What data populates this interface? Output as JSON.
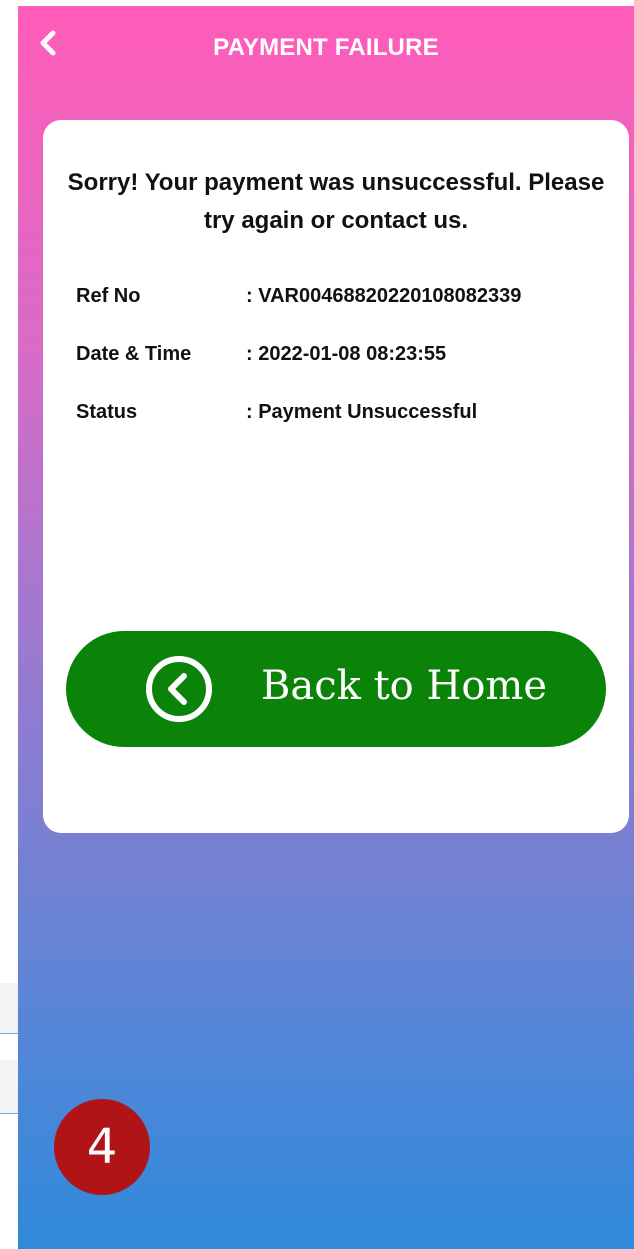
{
  "header": {
    "title": "PAYMENT FAILURE",
    "back_icon": "chevron-left-icon"
  },
  "card": {
    "message": "Sorry! Your payment was unsuccessful. Please try again or contact us.",
    "details": [
      {
        "label": "Ref No",
        "value": ": VAR00468820220108082339"
      },
      {
        "label": "Date & Time",
        "value": ": 2022-01-08 08:23:55"
      },
      {
        "label": "Status",
        "value": ": Payment Unsuccessful"
      }
    ],
    "home_button": {
      "label": "Back to Home",
      "icon": "circle-chevron-left-icon",
      "color": "#0a8308"
    }
  },
  "badge": {
    "text": "4",
    "color": "#b01416"
  },
  "colors": {
    "gradient_top": "#ff5cb8",
    "gradient_bottom": "#2f89d9",
    "card_background": "#ffffff"
  }
}
